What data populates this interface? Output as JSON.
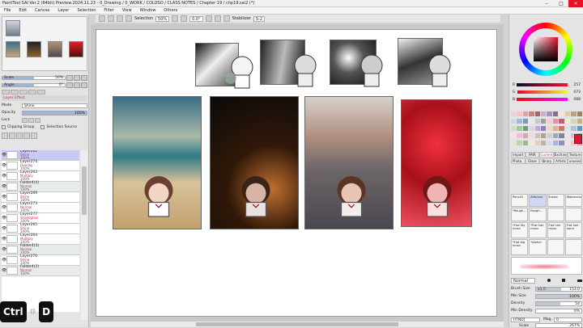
{
  "window": {
    "title": "PaintTool SAI Ver.2 (64bit) Preview.2024.11.23 - 0_Drawing / 0_WORK / COLOSO / CLASS NOTES / Chapter 19 / chp19.sai2 (*)",
    "minimize": "–",
    "maximize": "□",
    "close": "×"
  },
  "menu": [
    "File",
    "Edit",
    "Canvas",
    "Layer",
    "Selection",
    "Filter",
    "View",
    "Window",
    "Others"
  ],
  "toolbar": {
    "selection_label": "Selection",
    "zoom": "50%",
    "rotation": "0.0°",
    "stabilizer_label": "Stabilizer",
    "stabilizer": "S-2"
  },
  "left": {
    "scale": {
      "label": "Scale",
      "value": "50%",
      "fraction": 0.5
    },
    "angle": {
      "label": "Angle",
      "value": "0°",
      "fraction": 0.5
    },
    "layer_effect": "Layer Effect",
    "mode": {
      "label": "Mode",
      "value": "Shine"
    },
    "opacity": {
      "label": "Opacity",
      "value": "100%",
      "fraction": 1
    },
    "lock_label": "Lock",
    "clipping": "Clipping Group",
    "selection_source": "Selection Source",
    "layers": [
      {
        "name": "Layer262",
        "mode": "Shine",
        "opacity": "100%",
        "selected": true,
        "folder": false
      },
      {
        "name": "Layer274",
        "mode": "Overlay",
        "opacity": "100%",
        "selected": false,
        "folder": false
      },
      {
        "name": "Layer263",
        "mode": "Multiply",
        "opacity": "100%",
        "selected": false,
        "folder": false
      },
      {
        "name": "Folder4(4)",
        "mode": "Normal",
        "opacity": "100%",
        "selected": false,
        "folder": true
      },
      {
        "name": "Layer269",
        "mode": "Shine",
        "opacity": "100%",
        "selected": false,
        "folder": false
      },
      {
        "name": "Layer273",
        "mode": "Normal",
        "opacity": "100%",
        "selected": false,
        "folder": false
      },
      {
        "name": "Layer277",
        "mode": "Shadeglow",
        "opacity": "100%",
        "selected": false,
        "folder": false
      },
      {
        "name": "Layer265",
        "mode": "Shine",
        "opacity": "100%",
        "selected": false,
        "folder": false
      },
      {
        "name": "Layer264",
        "mode": "Multiply",
        "opacity": "100%",
        "selected": false,
        "folder": false
      },
      {
        "name": "Folder4(3)",
        "mode": "Normal",
        "opacity": "100%",
        "selected": false,
        "folder": true
      },
      {
        "name": "Layer270",
        "mode": "Shine",
        "opacity": "100%",
        "selected": false,
        "folder": false
      },
      {
        "name": "Folder4(2)",
        "mode": "Normal",
        "opacity": "100%",
        "selected": false,
        "folder": true
      }
    ]
  },
  "right": {
    "colors": {
      "primary": "#e81131"
    },
    "rgb": [
      {
        "ch": "R",
        "value": "257",
        "fraction": 1
      },
      {
        "ch": "G",
        "value": "073",
        "fraction": 0.29
      },
      {
        "ch": "B",
        "value": "088",
        "fraction": 0.35
      }
    ],
    "tabs1": [
      "Import",
      "PAIR",
      "Current",
      "Exchange",
      "Texture"
    ],
    "tabs2": [
      "Photo..",
      "Glaze",
      "library",
      "Artists",
      "unused"
    ],
    "brushes": [
      "Pencil3",
      "Airbrush",
      "Eraser",
      "Watercolor",
      "*Rough...",
      "Rough..",
      "",
      "",
      "*Flat Sty mnsn",
      "*Flat hair mnsn",
      "Flat hair mnsn",
      "Flat hair hand",
      "*Flat big mnsn",
      "*sketch",
      "",
      ""
    ],
    "brush_mode": "Normal",
    "brush_size": {
      "label": "Brush Size",
      "mult": "x1.0",
      "value": "153.0",
      "fraction": 0.55
    },
    "min_size": {
      "label": "Min Size",
      "value": "100%",
      "fraction": 1
    },
    "density": {
      "label": "Density",
      "value": "54",
      "fraction": 0.54
    },
    "min_density": {
      "label": "Min Density",
      "value": "0%",
      "fraction": 0
    },
    "texture": {
      "value": "[ITND]",
      "label": "Mag.",
      "num": "0"
    },
    "scale": {
      "label": "Scale",
      "value": "267%"
    },
    "invert": "Invert"
  },
  "shortcut": {
    "key1": "Ctrl",
    "plus": "+",
    "key2": "D"
  }
}
